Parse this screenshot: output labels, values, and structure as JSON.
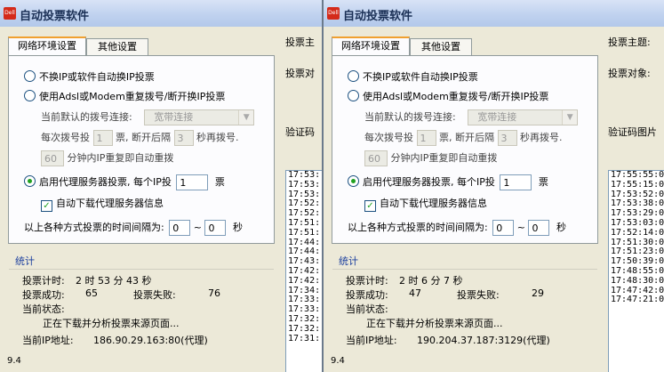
{
  "windows": [
    {
      "title": "自动投票软件",
      "tabs": [
        "网络环境设置",
        "其他设置"
      ],
      "options": {
        "no_switch_ip": "不换IP或软件自动换IP投票",
        "adsl_redial": "使用Adsl或Modem重复拨号/断开换IP投票",
        "current_dial_label": "当前默认的拨号连接:",
        "dial_connection": "宽带连接",
        "every_vote": "每次拨号投",
        "every_vote_value": "1",
        "unit_vote_after": "票, 断开后隔",
        "seconds_value": "3",
        "seconds_redial": "秒再拨号.",
        "minutes_value": "60",
        "minutes_text": "分钟内IP重复即自动重拨",
        "proxy_vote": "启用代理服务器投票, 每个IP投",
        "proxy_value": "1",
        "proxy_unit": "票",
        "auto_download": "自动下载代理服务器信息",
        "interval_label": "以上各种方式投票的时间间隔为:",
        "interval_from": "0",
        "interval_tilde": "~",
        "interval_to": "0",
        "interval_unit": "秒"
      },
      "stats": {
        "heading": "统计",
        "timer_label": "投票计时:",
        "timer_value": "2 时 53 分 43 秒",
        "success_label": "投票成功:",
        "success_value": "65",
        "fail_label": "投票失败:",
        "fail_value": "76",
        "status_label": "当前状态:",
        "status_value": "正在下载并分析投票来源页面...",
        "ip_label": "当前IP地址:",
        "ip_value": "186.90.29.163:80(代理)"
      },
      "version": "9.4",
      "right": {
        "topic_label": "投票主",
        "target_label": "投票对",
        "captcha_label": "验证码"
      },
      "log": [
        "17:53:",
        "17:53:",
        "17:53:",
        "17:52:",
        "17:52:",
        "17:51:",
        "17:51:",
        "17:44:",
        "17:44:",
        "17:43:",
        "17:42:",
        "17:42:",
        "17:34:",
        "17:33:",
        "17:33:",
        "17:32:",
        "17:32:",
        "17:31:"
      ]
    },
    {
      "title": "自动投票软件",
      "tabs": [
        "网络环境设置",
        "其他设置"
      ],
      "options": {
        "no_switch_ip": "不换IP或软件自动换IP投票",
        "adsl_redial": "使用Adsl或Modem重复拨号/断开换IP投票",
        "current_dial_label": "当前默认的拨号连接:",
        "dial_connection": "宽带连接",
        "every_vote": "每次拨号投",
        "every_vote_value": "1",
        "unit_vote_after": "票, 断开后隔",
        "seconds_value": "3",
        "seconds_redial": "秒再拨号.",
        "minutes_value": "60",
        "minutes_text": "分钟内IP重复即自动重拨",
        "proxy_vote": "启用代理服务器投票, 每个IP投",
        "proxy_value": "1",
        "proxy_unit": "票",
        "auto_download": "自动下载代理服务器信息",
        "interval_label": "以上各种方式投票的时间间隔为:",
        "interval_from": "0",
        "interval_tilde": "~",
        "interval_to": "0",
        "interval_unit": "秒"
      },
      "stats": {
        "heading": "统计",
        "timer_label": "投票计时:",
        "timer_value": "2 时 6 分 7 秒",
        "success_label": "投票成功:",
        "success_value": "47",
        "fail_label": "投票失败:",
        "fail_value": "29",
        "status_label": "当前状态:",
        "status_value": "正在下载并分析投票来源页面...",
        "ip_label": "当前IP地址:",
        "ip_value": "190.204.37.187:3129(代理)"
      },
      "version": "9.4",
      "right": {
        "topic_label": "投票主题:",
        "target_label": "投票对象:",
        "captcha_label": "验证码图片"
      },
      "log": [
        "17:55:55:0",
        "17:55:15:0",
        "17:53:52:0",
        "17:53:38:0",
        "17:53:29:0",
        "17:53:03:0",
        "17:52:14:0",
        "17:51:30:0",
        "17:51:23:0",
        "17:50:39:0",
        "17:48:55:0",
        "17:48:30:0",
        "17:47:42:0",
        "17:47:21:0"
      ]
    }
  ]
}
